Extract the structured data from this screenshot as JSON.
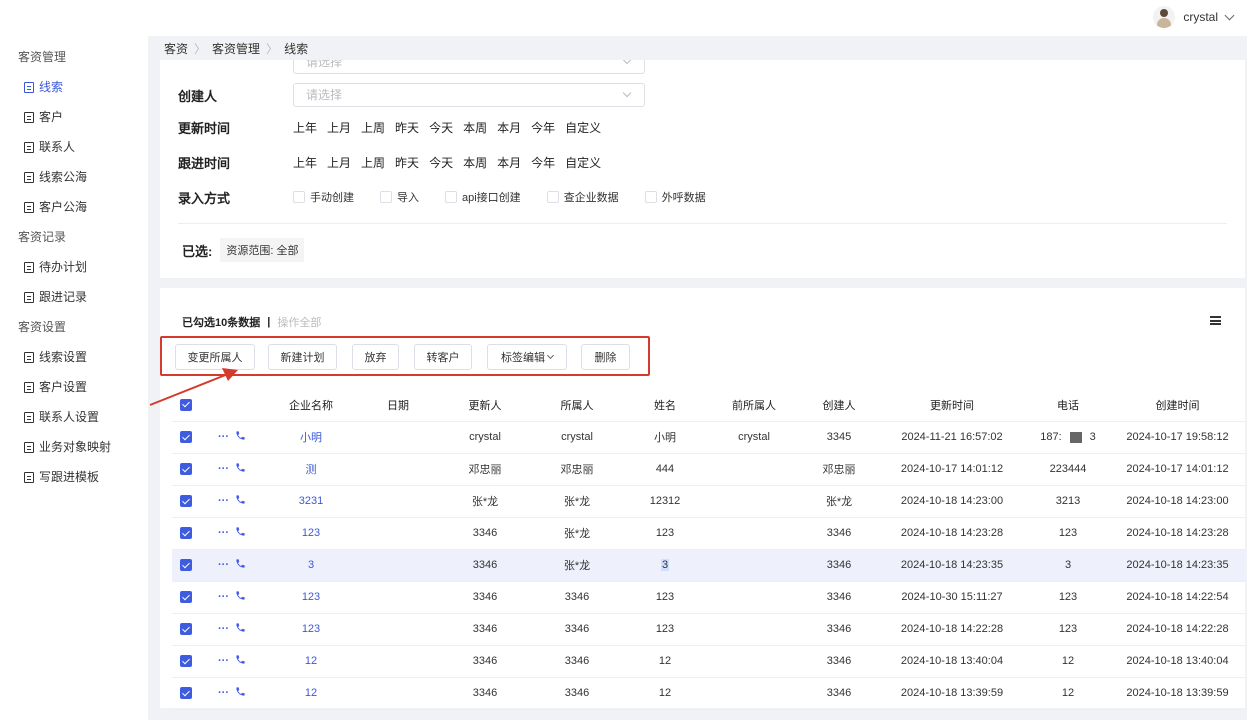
{
  "header": {
    "username": "crystal"
  },
  "sidebar": {
    "groups": [
      {
        "title": "客资管理",
        "items": [
          "线索",
          "客户",
          "联系人",
          "线索公海",
          "客户公海"
        ]
      },
      {
        "title": "客资记录",
        "items": [
          "待办计划",
          "跟进记录"
        ]
      },
      {
        "title": "客资设置",
        "items": [
          "线索设置",
          "客户设置",
          "联系人设置",
          "业务对象映射",
          "写跟进模板"
        ]
      }
    ],
    "active_item": "线索"
  },
  "breadcrumb": [
    "客资",
    "客资管理",
    "线索"
  ],
  "filters": {
    "partial_select_placeholder": "请选择",
    "creator_label": "创建人",
    "creator_placeholder": "请选择",
    "update_time_label": "更新时间",
    "follow_time_label": "跟进时间",
    "time_options": [
      "上年",
      "上月",
      "上周",
      "昨天",
      "今天",
      "本周",
      "本月",
      "今年",
      "自定义"
    ],
    "entry_method_label": "录入方式",
    "entry_methods": [
      "手动创建",
      "导入",
      "api接口创建",
      "查企业数据",
      "外呼数据"
    ],
    "selected_label": "已选:",
    "selected_tag": "资源范围: 全部"
  },
  "table_header": {
    "selected_count": "已勾选10条数据",
    "separator": "|",
    "operate_all": "操作全部"
  },
  "actions": [
    "变更所属人",
    "新建计划",
    "放弃",
    "转客户",
    "标签编辑",
    "删除"
  ],
  "table": {
    "columns": [
      "企业名称",
      "日期",
      "更新人",
      "所属人",
      "姓名",
      "前所属人",
      "创建人",
      "更新时间",
      "电话",
      "创建时间"
    ],
    "rows": [
      {
        "company": "小明",
        "date": "",
        "updater": "crystal",
        "owner": "crystal",
        "name": "小明",
        "prev_owner": "crystal",
        "creator": "3345",
        "updated": "2024-11-21 16:57:02",
        "phone_a": "187:",
        "phone_b": "3",
        "created": "2024-10-17 19:58:12"
      },
      {
        "company": "测",
        "date": "",
        "updater": "邓忠丽",
        "owner": "邓忠丽",
        "name": "444",
        "prev_owner": "",
        "creator": "邓忠丽",
        "updated": "2024-10-17 14:01:12",
        "phone": "223444",
        "created": "2024-10-17 14:01:12"
      },
      {
        "company": "3231",
        "date": "",
        "updater": "张*龙",
        "owner": "张*龙",
        "name": "12312",
        "prev_owner": "",
        "creator": "张*龙",
        "updated": "2024-10-18 14:23:00",
        "phone": "3213",
        "created": "2024-10-18 14:23:00"
      },
      {
        "company": "123",
        "date": "",
        "updater": "3346",
        "owner": "张*龙",
        "name": "123",
        "prev_owner": "",
        "creator": "3346",
        "updated": "2024-10-18 14:23:28",
        "phone": "123",
        "created": "2024-10-18 14:23:28"
      },
      {
        "company": "3",
        "date": "",
        "updater": "3346",
        "owner": "张*龙",
        "name": "3",
        "prev_owner": "",
        "creator": "3346",
        "updated": "2024-10-18 14:23:35",
        "phone": "3",
        "created": "2024-10-18 14:23:35"
      },
      {
        "company": "123",
        "date": "",
        "updater": "3346",
        "owner": "3346",
        "name": "123",
        "prev_owner": "",
        "creator": "3346",
        "updated": "2024-10-30 15:11:27",
        "phone": "123",
        "created": "2024-10-18 14:22:54"
      },
      {
        "company": "123",
        "date": "",
        "updater": "3346",
        "owner": "3346",
        "name": "123",
        "prev_owner": "",
        "creator": "3346",
        "updated": "2024-10-18 14:22:28",
        "phone": "123",
        "created": "2024-10-18 14:22:28"
      },
      {
        "company": "12",
        "date": "",
        "updater": "3346",
        "owner": "3346",
        "name": "12",
        "prev_owner": "",
        "creator": "3346",
        "updated": "2024-10-18 13:40:04",
        "phone": "12",
        "created": "2024-10-18 13:40:04"
      },
      {
        "company": "12",
        "date": "",
        "updater": "3346",
        "owner": "3346",
        "name": "12",
        "prev_owner": "",
        "creator": "3346",
        "updated": "2024-10-18 13:39:59",
        "phone": "12",
        "created": "2024-10-18 13:39:59"
      }
    ]
  },
  "colors": {
    "accent": "#3f5be0",
    "annotation_red": "#d43b2c"
  }
}
